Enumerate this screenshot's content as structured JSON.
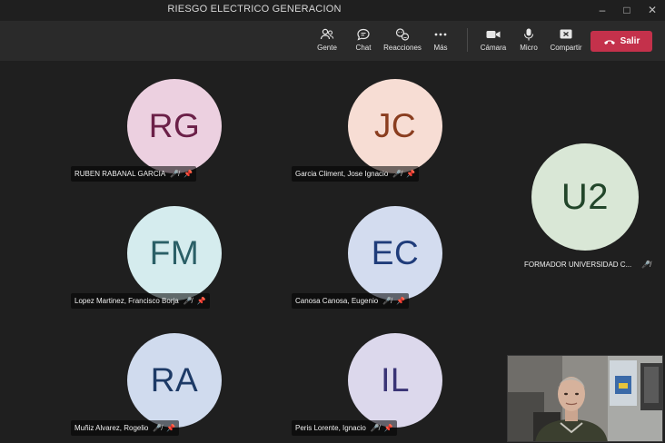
{
  "window": {
    "title": "RIESGO ELECTRICO GENERACION"
  },
  "toolbar": {
    "people_label": "Gente",
    "chat_label": "Chat",
    "reactions_label": "Reacciones",
    "more_label": "Más",
    "camera_label": "Cámara",
    "mic_label": "Micro",
    "share_label": "Compartir",
    "leave_label": "Salir"
  },
  "participants": [
    {
      "initials": "RG",
      "name": "RUBEN RABANAL GARCIA",
      "bg": "#ecd0e0",
      "fg": "#6b2048"
    },
    {
      "initials": "JC",
      "name": "Garcia Climent, Jose Ignacio",
      "bg": "#f7ddd4",
      "fg": "#8a3d1f"
    },
    {
      "initials": "U2",
      "name": "FORMADOR UNIVERSIDAD C...",
      "bg": "#d9e7d6",
      "fg": "#22462a"
    },
    {
      "initials": "FM",
      "name": "Lopez Martinez, Francisco Borja",
      "bg": "#d5ecee",
      "fg": "#2a5f66"
    },
    {
      "initials": "EC",
      "name": "Canosa Canosa, Eugenio",
      "bg": "#d3dcef",
      "fg": "#1f3c7a"
    },
    {
      "initials": "RA",
      "name": "Muñiz Alvarez, Rogelio",
      "bg": "#d0dbee",
      "fg": "#1d3a66"
    },
    {
      "initials": "IL",
      "name": "Peris Lorente, Ignacio",
      "bg": "#dcd8ec",
      "fg": "#3a3476"
    }
  ],
  "colors": {
    "accent_leave": "#c4314b",
    "toolbar_bg": "#2a2a2a",
    "stage_bg": "#1f1f1f"
  },
  "icons": [
    "people-icon",
    "chat-icon",
    "reactions-icon",
    "more-icon",
    "camera-icon",
    "mic-icon",
    "share-icon",
    "phone-hangup-icon",
    "mic-off-icon",
    "pin-icon"
  ]
}
